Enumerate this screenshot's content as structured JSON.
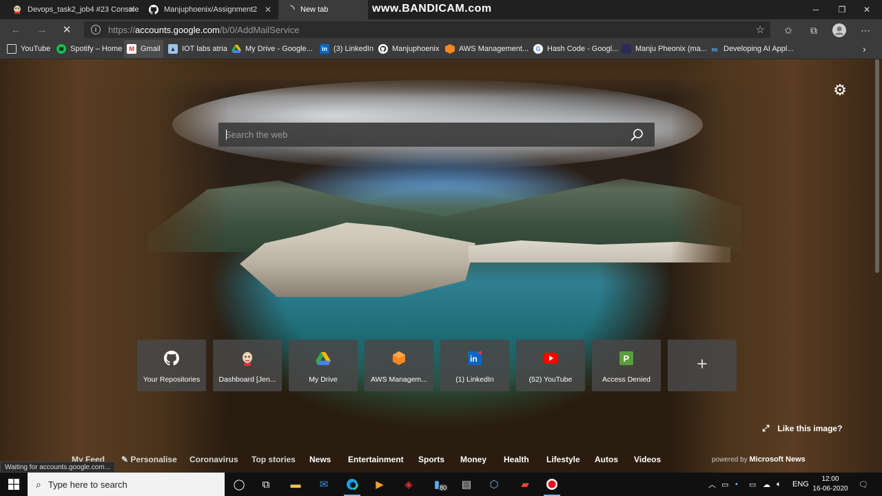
{
  "browser": {
    "tabs": [
      {
        "title": "Devops_task2_job4 #23 Console",
        "active": false
      },
      {
        "title": "Manjuphoenix/Assignment2",
        "active": false
      },
      {
        "title": "New tab",
        "active": true
      }
    ],
    "watermark": "www.BANDICAM.com",
    "url_prefix": "https://",
    "url_host": "accounts.google.com",
    "url_path": "/b/0/AddMailService",
    "bookmarks": [
      {
        "label": "YouTube",
        "icon": "youtube-icon"
      },
      {
        "label": "Spotify – Home",
        "icon": "spotify-icon"
      },
      {
        "label": "Gmail",
        "icon": "gmail-icon"
      },
      {
        "label": "IOT labs atria",
        "icon": "image-icon"
      },
      {
        "label": "My Drive - Google...",
        "icon": "drive-icon"
      },
      {
        "label": "(3) LinkedIn",
        "icon": "linkedin-icon"
      },
      {
        "label": "Manjuphoenix",
        "icon": "github-icon"
      },
      {
        "label": "AWS Management...",
        "icon": "aws-icon"
      },
      {
        "label": "Hash Code - Googl...",
        "icon": "google-icon"
      },
      {
        "label": "Manju Pheonix (ma...",
        "icon": "blank-icon"
      },
      {
        "label": "Developing AI Appl...",
        "icon": "infinity-icon"
      }
    ]
  },
  "newtab": {
    "search_placeholder": "Search the web",
    "tiles": [
      {
        "label": "Your Repositories",
        "icon": "github-icon"
      },
      {
        "label": "Dashboard [Jen...",
        "icon": "jenkins-icon"
      },
      {
        "label": "My Drive",
        "icon": "drive-icon"
      },
      {
        "label": "AWS Managem...",
        "icon": "aws-icon"
      },
      {
        "label": "(1) LinkedIn",
        "icon": "linkedin-icon"
      },
      {
        "label": "(52) YouTube",
        "icon": "youtube-icon"
      },
      {
        "label": "Access Denied",
        "icon": "p-icon"
      }
    ],
    "like_image": "Like this image?",
    "news_nav": [
      "My Feed",
      "Personalise",
      "Coronavirus",
      "Top stories",
      "News",
      "Entertainment",
      "Sports",
      "Money",
      "Health",
      "Lifestyle",
      "Autos",
      "Videos"
    ],
    "powered_by": "powered by",
    "powered_brand": "Microsoft News",
    "status": "Waiting for accounts.google.com..."
  },
  "taskbar": {
    "search_placeholder": "Type here to search",
    "badge_count": "80",
    "language": "ENG",
    "time": "12:00",
    "date": "16-06-2020"
  },
  "colors": {
    "accent": "#0078d7",
    "youtube_red": "#ff0000",
    "linkedin_blue": "#0a66c2",
    "aws_orange": "#f7881f"
  }
}
